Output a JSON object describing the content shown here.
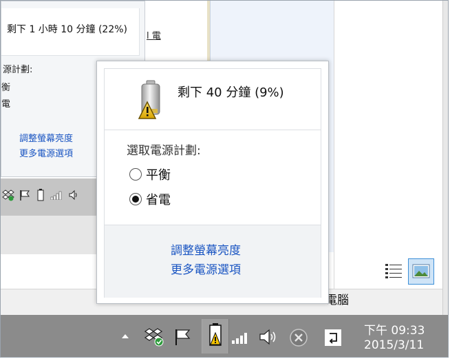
{
  "flyout": {
    "status": "剩下 40 分鐘 (9%)",
    "plan_header": "選取電源計劃:",
    "plans": [
      {
        "label": "平衡",
        "selected": false
      },
      {
        "label": "省電",
        "selected": true
      }
    ],
    "links": {
      "brightness": "調整螢幕亮度",
      "more_options": "更多電源選項"
    }
  },
  "background_window": {
    "status": "剩下 1 小時 10 分鐘 (22%)",
    "plan_header": "源計劃:",
    "plan_a": "衡",
    "plan_b": "電",
    "links": {
      "brightness": "調整螢幕亮度",
      "more_options": "更多電源選項"
    },
    "underlined_fragment": "l 電",
    "computer_label": "電腦"
  },
  "taskbar": {
    "time": "下午 09:33",
    "date": "2015/3/11",
    "icons": [
      "show-hidden-icon",
      "dropbox-icon",
      "action-center-flag-icon",
      "battery-warning-icon",
      "network-signal-icon",
      "volume-icon",
      "close-circle-icon",
      "input-method-icon"
    ]
  },
  "colors": {
    "link": "#1a55c2",
    "taskbar": "#8b8b8b",
    "footer": "#f1f3f5"
  }
}
